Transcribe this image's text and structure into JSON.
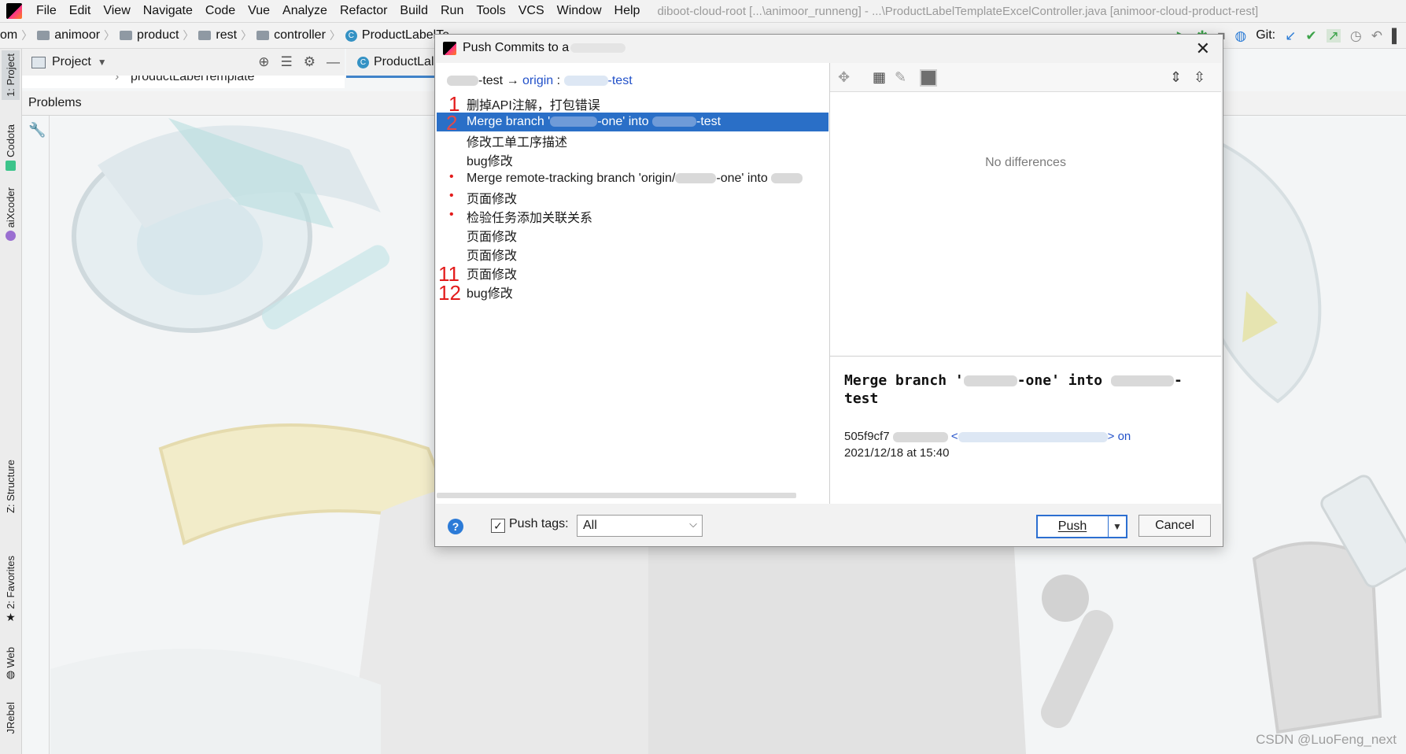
{
  "menubar": {
    "items": [
      "File",
      "Edit",
      "View",
      "Navigate",
      "Code",
      "Vue",
      "Analyze",
      "Refactor",
      "Build",
      "Run",
      "Tools",
      "VCS",
      "Window",
      "Help"
    ],
    "window_title": "diboot-cloud-root [...\\animoor_runneng] - ...\\ProductLabelTemplateExcelController.java [animoor-cloud-product-rest]"
  },
  "breadcrumb": {
    "prefix": "om",
    "items": [
      "animoor",
      "product",
      "rest",
      "controller",
      "ProductLabelTe"
    ]
  },
  "toolbar": {
    "git_label": "Git:"
  },
  "left_stripe": {
    "tabs": [
      "1: Project",
      "Codota",
      "aiXcoder",
      "Z: Structure",
      "2: Favorites",
      "Web",
      "JRebel"
    ]
  },
  "project": {
    "header": "Project",
    "tree_item": "productLabelTemplate"
  },
  "editor": {
    "tab_label": "ProductLal"
  },
  "problems": {
    "label": "Problems"
  },
  "dialog": {
    "title": "Push Commits to a",
    "branch": {
      "local_suffix": "-test",
      "arrow": "→",
      "remote": "origin",
      "colon": ":",
      "remote_suffix": "-test"
    },
    "commits": [
      "删掉API注解，打包错误",
      "Merge branch '",
      "修改工单工序描述",
      "bug修改",
      "Merge remote-tracking branch 'origin/",
      "页面修改",
      "检验任务添加关联关系",
      "页面修改",
      "页面修改",
      "页面修改",
      "bug修改"
    ],
    "commit2_mid": "-one' into ",
    "commit2_end": "-test",
    "commit5_mid": "-one' into",
    "annotations": [
      "1",
      "2",
      "11",
      "12"
    ],
    "no_differences": "No differences",
    "details": {
      "title_a": "Merge branch '",
      "title_b": "-one' into",
      "title_c": "-",
      "title_d": "test",
      "hash": "505f9cf7",
      "email_open": "<",
      "email_close": "> on",
      "date": "2021/12/18 at 15:40"
    },
    "push_tags_label": "Push tags:",
    "push_tags_value": "All",
    "push_button": "Push",
    "cancel_button": "Cancel",
    "help_icon": "?"
  },
  "watermark": "CSDN @LuoFeng_next",
  "colors": {
    "selection": "#2a6fc7",
    "annotation_red": "#e31b1b",
    "link_blue": "#2251c9"
  }
}
